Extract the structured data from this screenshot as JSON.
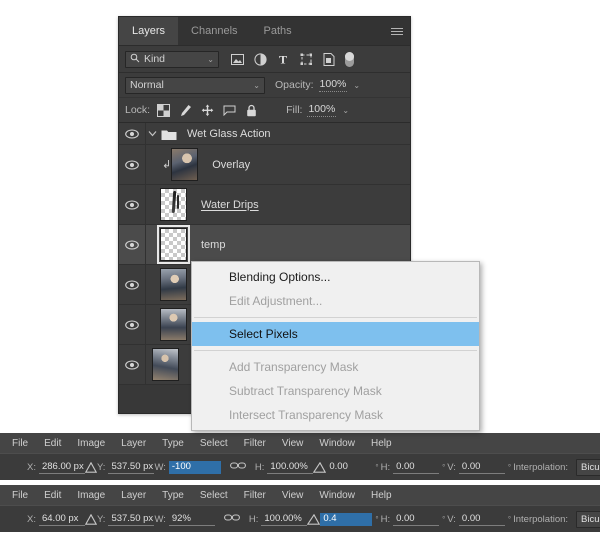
{
  "layers_panel": {
    "tabs": [
      {
        "label": "Layers",
        "active": true
      },
      {
        "label": "Channels",
        "active": false
      },
      {
        "label": "Paths",
        "active": false
      }
    ],
    "panel_menu_icon": "hamburger-icon",
    "filter_row": {
      "search_icon": "magnifier-icon",
      "kind_label": "Kind",
      "dropdown_caret": "⌄",
      "filter_icons": [
        "image-filter-icon",
        "adjustment-filter-icon",
        "type-filter-icon",
        "shape-filter-icon",
        "smartobject-filter-icon"
      ],
      "toggle": "filter-toggle-switch"
    },
    "blend_row": {
      "blend_mode": "Normal",
      "dropdown_caret": "⌄",
      "opacity_label": "Opacity:",
      "opacity_value": "100%"
    },
    "lock_row": {
      "lock_label": "Lock:",
      "lock_icons": [
        "lock-transparent-pixels-icon",
        "lock-image-pixels-icon",
        "lock-position-icon",
        "lock-artboard-nesting-icon",
        "lock-all-icon"
      ],
      "fill_label": "Fill:",
      "fill_value": "100%"
    },
    "layers": [
      {
        "name": "Wet Glass Action",
        "type": "group",
        "visible": true,
        "expanded": true,
        "selected": false,
        "thumb": "none"
      },
      {
        "name": "Overlay",
        "type": "clipped-image",
        "visible": true,
        "selected": false,
        "thumb": "photo",
        "clipped": true
      },
      {
        "name": "Water Drips ",
        "type": "image",
        "visible": true,
        "selected": false,
        "thumb": "transparent-drips",
        "underlined": true
      },
      {
        "name": "temp",
        "type": "image",
        "visible": true,
        "selected": true,
        "thumb": "transparent-drips"
      },
      {
        "name": "",
        "type": "image",
        "visible": true,
        "selected": false,
        "thumb": "photo"
      },
      {
        "name": "",
        "type": "image",
        "visible": true,
        "selected": false,
        "thumb": "photo"
      },
      {
        "name": "",
        "type": "image",
        "visible": true,
        "selected": false,
        "thumb": "photo"
      }
    ]
  },
  "context_menu": {
    "items": [
      {
        "label": "Blending Options...",
        "state": "enabled"
      },
      {
        "label": "Edit Adjustment...",
        "state": "disabled"
      },
      {
        "separator_after": true
      },
      {
        "label": "Select Pixels",
        "state": "highlighted"
      },
      {
        "separator_after": true
      },
      {
        "label": "Add Transparency Mask",
        "state": "disabled"
      },
      {
        "label": "Subtract Transparency Mask",
        "state": "disabled"
      },
      {
        "label": "Intersect Transparency Mask",
        "state": "disabled"
      }
    ],
    "highlight_color": "#7ec0ee"
  },
  "menubar": {
    "items": [
      "File",
      "Edit",
      "Image",
      "Layer",
      "Type",
      "Select",
      "Filter",
      "View",
      "Window",
      "Help"
    ]
  },
  "option_bars": [
    {
      "reference_point_icon": "reference-point-grid",
      "x_label": "X:",
      "x_value": "286.00 px",
      "delta_icon": "delta-icon",
      "y_label": "Y:",
      "y_value": "537.50 px",
      "w_label": "W:",
      "w_value": "-100",
      "w_selected": true,
      "link_icon": "link-chain-icon",
      "h_label": "H:",
      "h_value": "100.00%",
      "angle_icon": "angle-icon",
      "angle_value": "0.00",
      "angle_selected": false,
      "degree": "°",
      "skew_h_label": "H:",
      "skew_h_value": "0.00",
      "skew_v_label": "V:",
      "skew_v_value": "0.00",
      "interpolation_label": "Interpolation:",
      "interpolation_value": "Bicubic",
      "dropdown_caret": "⌄",
      "warp_icon": "warp-mode-icon",
      "cancel_icon": "cancel-transform-icon",
      "commit_icon": "commit-transform-icon"
    },
    {
      "reference_point_icon": "reference-point-grid",
      "x_label": "X:",
      "x_value": "64.00 px",
      "delta_icon": "delta-icon",
      "y_label": "Y:",
      "y_value": "537.50 px",
      "w_label": "W:",
      "w_value": "92%",
      "w_selected": false,
      "link_icon": "link-chain-icon",
      "h_label": "H:",
      "h_value": "100.00%",
      "angle_icon": "angle-icon",
      "angle_value": "0.4",
      "angle_selected": true,
      "degree": "°",
      "skew_h_label": "H:",
      "skew_h_value": "0.00",
      "skew_v_label": "V:",
      "skew_v_value": "0.00",
      "interpolation_label": "Interpolation:",
      "interpolation_value": "Bicubic",
      "dropdown_caret": "⌄",
      "warp_icon": "warp-mode-icon",
      "cancel_icon": "cancel-transform-icon",
      "commit_icon": "commit-transform-icon"
    }
  ]
}
